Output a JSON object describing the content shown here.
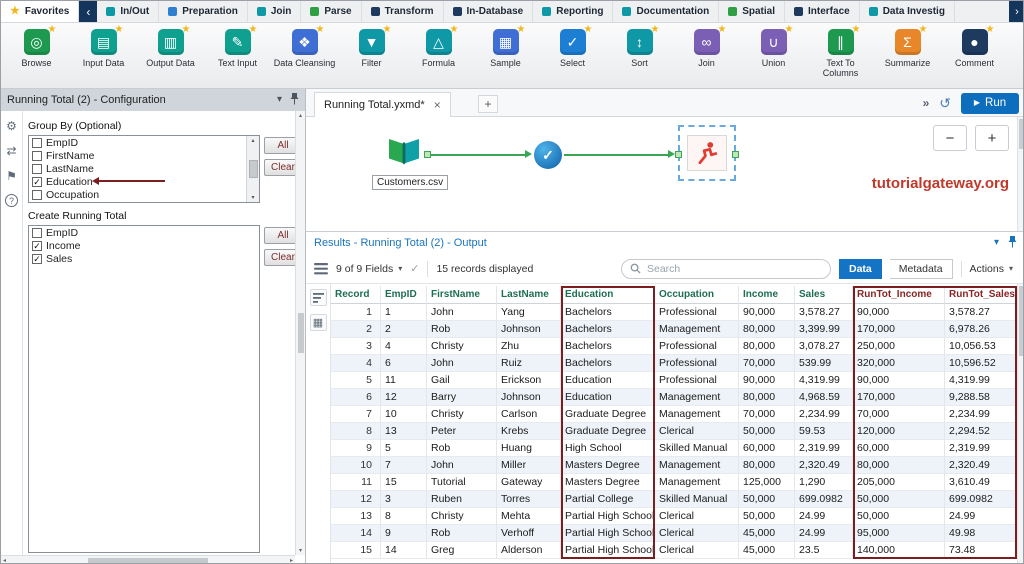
{
  "colors": {
    "accent_blue": "#1473c4",
    "run_blue": "#0d6ebd",
    "annotation_red": "#7a1f1f",
    "header_green": "#1e6e52",
    "header_maroon": "#8b2424",
    "star_yellow": "#f2b71e",
    "connection_green": "#3aa655"
  },
  "icons": {
    "chevron_down": "▾",
    "play": "▶",
    "back_chevron": "‹",
    "forward_chevron": "›",
    "chevrons_right": "»",
    "history": "↺",
    "check": "✓"
  },
  "ribbon": {
    "tabs": [
      {
        "label": "Favorites",
        "icon": "favorites-star",
        "star": true,
        "active": true
      },
      {
        "label": "In/Out",
        "icon": "in-out",
        "color": "#0f98a6"
      },
      {
        "label": "Preparation",
        "icon": "preparation",
        "color": "#2f7fd0"
      },
      {
        "label": "Join",
        "icon": "join",
        "color": "#0f98a6"
      },
      {
        "label": "Parse",
        "icon": "parse",
        "color": "#2f9e44"
      },
      {
        "label": "Transform",
        "icon": "transform",
        "color": "#1e3a5f"
      },
      {
        "label": "In-Database",
        "icon": "in-database",
        "color": "#1e3a5f"
      },
      {
        "label": "Reporting",
        "icon": "reporting",
        "color": "#0f98a6"
      },
      {
        "label": "Documentation",
        "icon": "documentation",
        "color": "#0f98a6"
      },
      {
        "label": "Spatial",
        "icon": "spatial",
        "color": "#2f9e44"
      },
      {
        "label": "Interface",
        "icon": "interface",
        "color": "#1e3a5f"
      },
      {
        "label": "Data Investig",
        "icon": "data-investigation",
        "color": "#0f98a6"
      }
    ]
  },
  "toolbar": {
    "tools": [
      {
        "label": "Browse",
        "glyph": "◎",
        "color": "#1d9a50"
      },
      {
        "label": "Input Data",
        "glyph": "▤",
        "color": "#0fa090"
      },
      {
        "label": "Output Data",
        "glyph": "▥",
        "color": "#0fa090"
      },
      {
        "label": "Text Input",
        "glyph": "✎",
        "color": "#0fa090"
      },
      {
        "label": "Data Cleansing",
        "glyph": "❖",
        "color": "#3f6fd4"
      },
      {
        "label": "Filter",
        "glyph": "▼",
        "color": "#0f98a6"
      },
      {
        "label": "Formula",
        "glyph": "△",
        "color": "#0f98a6"
      },
      {
        "label": "Sample",
        "glyph": "▦",
        "color": "#3f6fd4"
      },
      {
        "label": "Select",
        "glyph": "✓",
        "color": "#1d7fd4"
      },
      {
        "label": "Sort",
        "glyph": "↕",
        "color": "#0f98a6"
      },
      {
        "label": "Join",
        "glyph": "∞",
        "color": "#7a5fb5"
      },
      {
        "label": "Union",
        "glyph": "∪",
        "color": "#7a5fb5"
      },
      {
        "label": "Text To Columns",
        "glyph": "∥",
        "color": "#1d9a50"
      },
      {
        "label": "Summarize",
        "glyph": "Σ",
        "color": "#e8872a"
      },
      {
        "label": "Comment",
        "glyph": "●",
        "color": "#1e3a5f"
      }
    ]
  },
  "config": {
    "title": "Running Total (2) - Configuration",
    "group_by_label": "Group By (Optional)",
    "group_by_items": [
      {
        "label": "EmpID",
        "checked": false
      },
      {
        "label": "FirstName",
        "checked": false
      },
      {
        "label": "LastName",
        "checked": false
      },
      {
        "label": "Education",
        "checked": true
      },
      {
        "label": "Occupation",
        "checked": false
      }
    ],
    "all_label": "All",
    "clear_label": "Clear",
    "running_total_label": "Create Running Total",
    "running_total_items": [
      {
        "label": "EmpID",
        "checked": false
      },
      {
        "label": "Income",
        "checked": true
      },
      {
        "label": "Sales",
        "checked": true
      }
    ]
  },
  "canvas": {
    "tab_title": "Running Total.yxmd*",
    "tab_close": "×",
    "new_tab": "+",
    "run_label": "Run",
    "zoom_out": "−",
    "zoom_in": "+",
    "input_node_label": "Customers.csv",
    "watermark": "tutorialgateway.org"
  },
  "results": {
    "title": "Results - Running Total (2) - Output",
    "fields_summary": "9 of 9 Fields",
    "records_summary": "15 records displayed",
    "search_placeholder": "Search",
    "data_label": "Data",
    "metadata_label": "Metadata",
    "actions_label": "Actions",
    "table": {
      "columns": [
        "Record",
        "EmpID",
        "FirstName",
        "LastName",
        "Education",
        "Occupation",
        "Income",
        "Sales",
        "RunTot_Income",
        "RunTot_Sales"
      ],
      "rows": [
        [
          "1",
          "1",
          "John",
          "Yang",
          "Bachelors",
          "Professional",
          "90,000",
          "3,578.27",
          "90,000",
          "3,578.27"
        ],
        [
          "2",
          "2",
          "Rob",
          "Johnson",
          "Bachelors",
          "Management",
          "80,000",
          "3,399.99",
          "170,000",
          "6,978.26"
        ],
        [
          "3",
          "4",
          "Christy",
          "Zhu",
          "Bachelors",
          "Professional",
          "80,000",
          "3,078.27",
          "250,000",
          "10,056.53"
        ],
        [
          "4",
          "6",
          "John",
          "Ruiz",
          "Bachelors",
          "Professional",
          "70,000",
          "539.99",
          "320,000",
          "10,596.52"
        ],
        [
          "5",
          "11",
          "Gail",
          "Erickson",
          "Education",
          "Professional",
          "90,000",
          "4,319.99",
          "90,000",
          "4,319.99"
        ],
        [
          "6",
          "12",
          "Barry",
          "Johnson",
          "Education",
          "Management",
          "80,000",
          "4,968.59",
          "170,000",
          "9,288.58"
        ],
        [
          "7",
          "10",
          "Christy",
          "Carlson",
          "Graduate Degree",
          "Management",
          "70,000",
          "2,234.99",
          "70,000",
          "2,234.99"
        ],
        [
          "8",
          "13",
          "Peter",
          "Krebs",
          "Graduate Degree",
          "Clerical",
          "50,000",
          "59.53",
          "120,000",
          "2,294.52"
        ],
        [
          "9",
          "5",
          "Rob",
          "Huang",
          "High School",
          "Skilled Manual",
          "60,000",
          "2,319.99",
          "60,000",
          "2,319.99"
        ],
        [
          "10",
          "7",
          "John",
          "Miller",
          "Masters Degree",
          "Management",
          "80,000",
          "2,320.49",
          "80,000",
          "2,320.49"
        ],
        [
          "11",
          "15",
          "Tutorial",
          "Gateway",
          "Masters Degree",
          "Management",
          "125,000",
          "1,290",
          "205,000",
          "3,610.49"
        ],
        [
          "12",
          "3",
          "Ruben",
          "Torres",
          "Partial College",
          "Skilled Manual",
          "50,000",
          "699.0982",
          "50,000",
          "699.0982"
        ],
        [
          "13",
          "8",
          "Christy",
          "Mehta",
          "Partial High School",
          "Clerical",
          "50,000",
          "24.99",
          "50,000",
          "24.99"
        ],
        [
          "14",
          "9",
          "Rob",
          "Verhoff",
          "Partial High School",
          "Clerical",
          "45,000",
          "24.99",
          "95,000",
          "49.98"
        ],
        [
          "15",
          "14",
          "Greg",
          "Alderson",
          "Partial High School",
          "Clerical",
          "45,000",
          "23.5",
          "140,000",
          "73.48"
        ]
      ]
    }
  }
}
